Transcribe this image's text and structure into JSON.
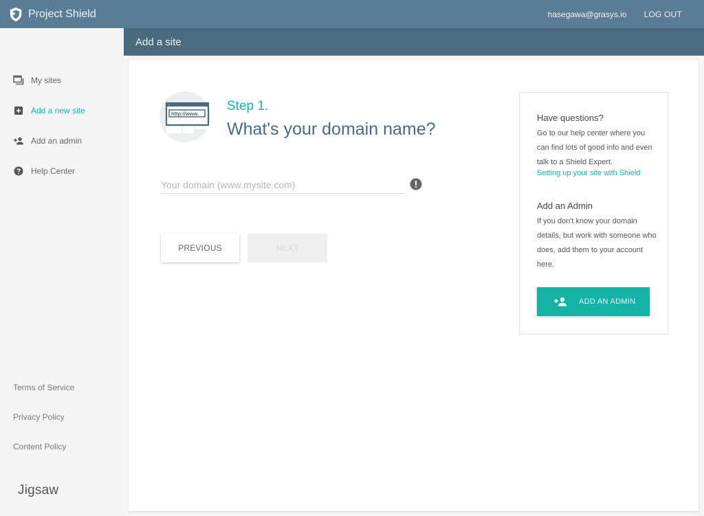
{
  "header": {
    "brand": "Project Shield",
    "user_email": "hasegawa@grasys.io",
    "logout_label": "LOG OUT"
  },
  "subheader": {
    "title": "Add a site"
  },
  "sidebar": {
    "items": [
      {
        "label": "My sites",
        "icon": "my-sites-icon"
      },
      {
        "label": "Add a new site",
        "icon": "add-box-icon",
        "active": true
      },
      {
        "label": "Add an admin",
        "icon": "person-add-icon"
      },
      {
        "label": "Help Center",
        "icon": "help-icon"
      }
    ],
    "footer": [
      "Terms of Service",
      "Privacy Policy",
      "Content Policy"
    ],
    "logo": "Jigsaw"
  },
  "main": {
    "step_label": "Step 1.",
    "headline": "What's your domain name?",
    "domain_input": {
      "value": "",
      "placeholder": "Your domain (www.mysite.com)"
    },
    "illustration_text": "http://www.",
    "previous_label": "PREVIOUS",
    "next_label": "NEXT"
  },
  "help": {
    "questions_title": "Have questions?",
    "questions_text": "Go to our help center where you can find lots of good info and even talk to a Shield Expert.",
    "questions_link": "Setting up your site with Shield",
    "admin_title": "Add an Admin",
    "admin_text": "If you don't know your domain details, but work with someone who does, add them to your account here.",
    "admin_button": "ADD AN ADMIN"
  },
  "colors": {
    "topbar": "#5a7d95",
    "subheader": "#4a6b7e",
    "accent": "#14b3a6",
    "background": "#f5f5f5"
  }
}
